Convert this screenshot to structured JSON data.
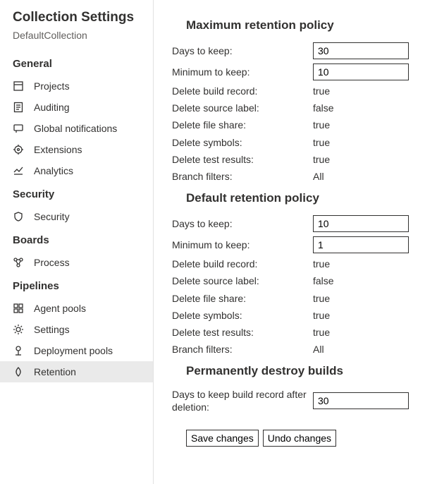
{
  "sidebar": {
    "title": "Collection Settings",
    "collection": "DefaultCollection",
    "groups": [
      {
        "label": "General",
        "items": [
          {
            "label": "Projects",
            "icon": "projects-icon"
          },
          {
            "label": "Auditing",
            "icon": "auditing-icon"
          },
          {
            "label": "Global notifications",
            "icon": "notifications-icon"
          },
          {
            "label": "Extensions",
            "icon": "extensions-icon"
          },
          {
            "label": "Analytics",
            "icon": "analytics-icon"
          }
        ]
      },
      {
        "label": "Security",
        "items": [
          {
            "label": "Security",
            "icon": "shield-icon"
          }
        ]
      },
      {
        "label": "Boards",
        "items": [
          {
            "label": "Process",
            "icon": "process-icon"
          }
        ]
      },
      {
        "label": "Pipelines",
        "items": [
          {
            "label": "Agent pools",
            "icon": "agent-pools-icon"
          },
          {
            "label": "Settings",
            "icon": "gear-icon"
          },
          {
            "label": "Deployment pools",
            "icon": "deployment-icon"
          },
          {
            "label": "Retention",
            "icon": "retention-icon",
            "active": true
          }
        ]
      }
    ]
  },
  "main": {
    "sections": {
      "max": {
        "heading": "Maximum retention policy",
        "days_label": "Days to keep:",
        "days_value": "30",
        "min_label": "Minimum to keep:",
        "min_value": "10",
        "rows": [
          {
            "label": "Delete build record:",
            "value": "true"
          },
          {
            "label": "Delete source label:",
            "value": "false"
          },
          {
            "label": "Delete file share:",
            "value": "true"
          },
          {
            "label": "Delete symbols:",
            "value": "true"
          },
          {
            "label": "Delete test results:",
            "value": "true"
          },
          {
            "label": "Branch filters:",
            "value": "All"
          }
        ]
      },
      "def": {
        "heading": "Default retention policy",
        "days_label": "Days to keep:",
        "days_value": "10",
        "min_label": "Minimum to keep:",
        "min_value": "1",
        "rows": [
          {
            "label": "Delete build record:",
            "value": "true"
          },
          {
            "label": "Delete source label:",
            "value": "false"
          },
          {
            "label": "Delete file share:",
            "value": "true"
          },
          {
            "label": "Delete symbols:",
            "value": "true"
          },
          {
            "label": "Delete test results:",
            "value": "true"
          },
          {
            "label": "Branch filters:",
            "value": "All"
          }
        ]
      },
      "destroy": {
        "heading": "Permanently destroy builds",
        "days_label": "Days to keep build record after deletion:",
        "days_value": "30"
      }
    },
    "buttons": {
      "save": "Save changes",
      "undo": "Undo changes"
    }
  }
}
